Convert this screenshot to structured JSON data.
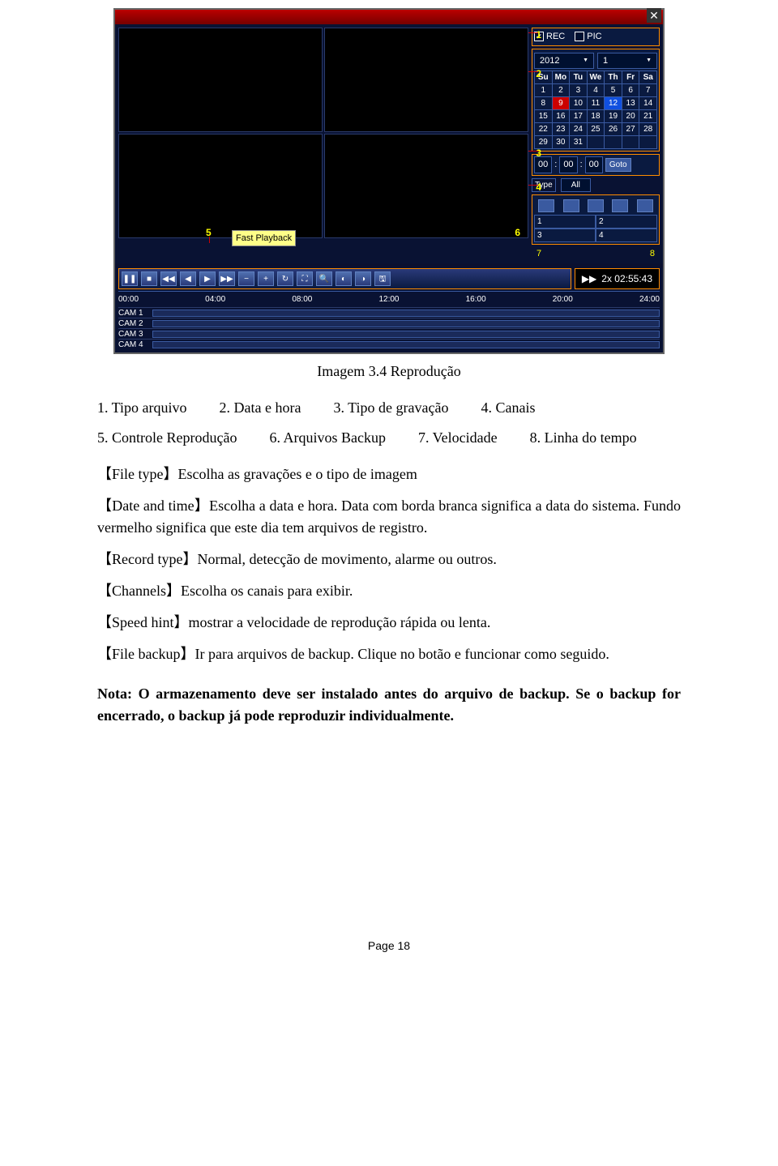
{
  "dvr": {
    "close": "✕",
    "rec_label": "REC",
    "pic_label": "PIC",
    "year": "2012",
    "month": "1",
    "weekdays": [
      "Su",
      "Mo",
      "Tu",
      "We",
      "Th",
      "Fr",
      "Sa"
    ],
    "calendar_rows": [
      [
        "1",
        "2",
        "3",
        "4",
        "5",
        "6",
        "7"
      ],
      [
        "8",
        "9",
        "10",
        "11",
        "12",
        "13",
        "14"
      ],
      [
        "15",
        "16",
        "17",
        "18",
        "19",
        "20",
        "21"
      ],
      [
        "22",
        "23",
        "24",
        "25",
        "26",
        "27",
        "28"
      ],
      [
        "29",
        "30",
        "31",
        "",
        "",
        "",
        ""
      ]
    ],
    "day_red": "9",
    "day_blue": "12",
    "time_h": "00",
    "time_m": "00",
    "time_s": "00",
    "goto": "Goto",
    "type_label": "Type",
    "type_value": "All",
    "channels": [
      "1",
      "2",
      "3",
      "4"
    ],
    "speed": "2x 02:55:43",
    "fast_playback": "Fast Playback",
    "ruler": [
      "00:00",
      "04:00",
      "08:00",
      "12:00",
      "16:00",
      "20:00",
      "24:00"
    ],
    "cams": [
      "CAM 1",
      "CAM 2",
      "CAM 3",
      "CAM 4"
    ],
    "markers": {
      "m1": "1",
      "m2": "2",
      "m3": "3",
      "m4": "4",
      "m5": "5",
      "m6": "6",
      "m7": "7",
      "m8": "8"
    }
  },
  "caption": "Imagem 3.4 Reprodução",
  "legend": {
    "r1c1": "1. Tipo arquivo",
    "r1c2": "2. Data e hora",
    "r1c3": "3. Tipo de gravação",
    "r1c4": "4. Canais",
    "r2c1": "5. Controle Reprodução",
    "r2c2": "6. Arquivos Backup",
    "r2c3": "7. Velocidade",
    "r2c4": "8. Linha do tempo"
  },
  "defs": {
    "file_type": "【File type】Escolha as gravações e o tipo de imagem",
    "date_time": "【Date and time】Escolha a data e hora. Data com borda branca significa a data do sistema. Fundo vermelho significa que este dia tem arquivos de registro.",
    "record_type": "【Record type】Normal, detecção de movimento, alarme ou outros.",
    "channels": "【Channels】Escolha os canais para exibir.",
    "speed_hint": "【Speed hint】mostrar a velocidade de reprodução rápida ou lenta.",
    "file_backup": "【File backup】Ir para arquivos de backup. Clique no botão e funcionar como seguido."
  },
  "note": "Nota: O armazenamento deve ser instalado antes do arquivo de backup. Se o backup for encerrado, o backup já pode reproduzir individualmente.",
  "page": "Page 18"
}
